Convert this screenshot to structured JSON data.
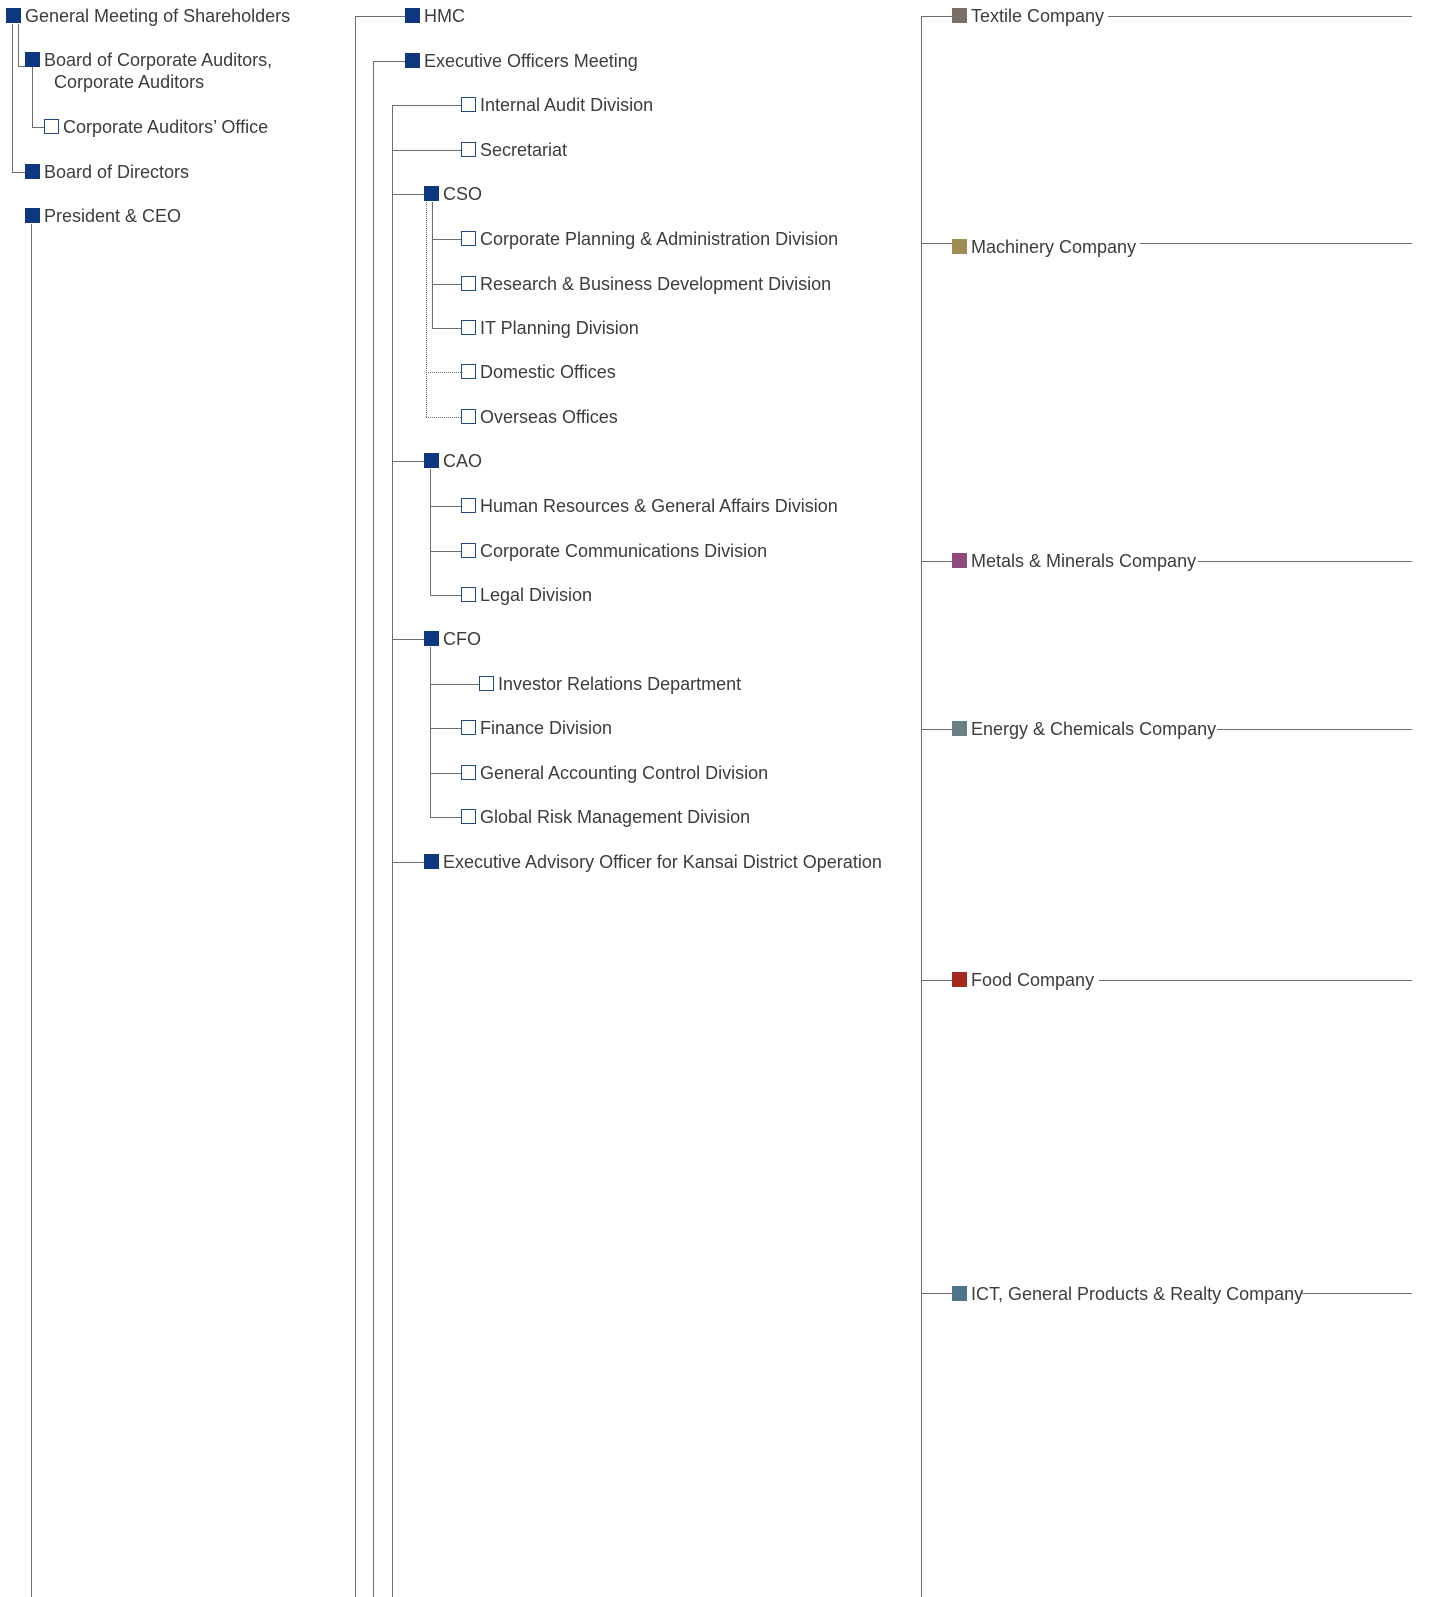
{
  "colors": {
    "node_fill": "#0d3880",
    "line": "#6e6e6e",
    "text": "#3c3c3c"
  },
  "left": {
    "general_meeting": "General Meeting of Shareholders",
    "board_of_corporate_auditors": "Board of Corporate Auditors,\n  Corporate Auditors",
    "corporate_auditors_office": "Corporate Auditors’ Office",
    "board_of_directors": "Board of Directors",
    "president_ceo": "President & CEO"
  },
  "middle": {
    "hmc": "HMC",
    "executive_officers_meeting": "Executive Officers Meeting",
    "internal_audit_division": "Internal Audit Division",
    "secretariat": "Secretariat",
    "cso": {
      "label": "CSO",
      "children": [
        "Corporate Planning & Administration Division",
        "Research & Business Development Division",
        "IT Planning Division",
        "Domestic Offices",
        "Overseas Offices"
      ]
    },
    "cao": {
      "label": "CAO",
      "children": [
        "Human Resources & General Affairs Division",
        "Corporate Communications Division",
        "Legal Division"
      ]
    },
    "cfo": {
      "label": "CFO",
      "children": [
        "Investor Relations Department",
        "Finance Division",
        "General Accounting Control Division",
        "Global Risk Management Division"
      ]
    },
    "kansai_officer": "Executive Advisory Officer for Kansai District Operation"
  },
  "companies": [
    {
      "name": "Textile Company",
      "color": "#7d6e63"
    },
    {
      "name": "Machinery Company",
      "color": "#9c8d55"
    },
    {
      "name": "Metals & Minerals Company",
      "color": "#8e4a7c"
    },
    {
      "name": "Energy & Chemicals Company",
      "color": "#6c7e87"
    },
    {
      "name": "Food Company",
      "color": "#a5291e"
    },
    {
      "name": "ICT, General Products & Realty Company",
      "color": "#4e7489"
    }
  ]
}
